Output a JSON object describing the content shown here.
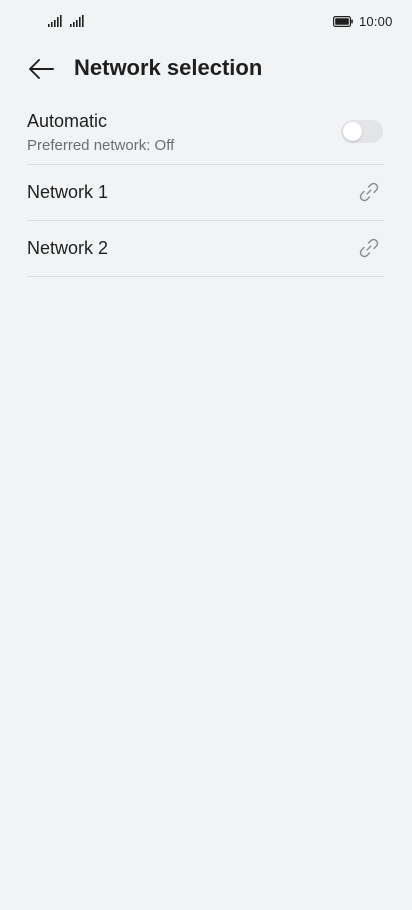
{
  "status_bar": {
    "time": "10:00",
    "icons": [
      "signal-icon",
      "signal-icon",
      "battery-icon"
    ]
  },
  "header": {
    "back_icon": "arrow-left-icon",
    "title": "Network selection"
  },
  "automatic": {
    "title": "Automatic",
    "subtitle": "Preferred network: Off",
    "toggle_on": false
  },
  "networks": [
    {
      "label": "Network 1",
      "icon": "link-icon"
    },
    {
      "label": "Network 2",
      "icon": "link-icon"
    }
  ],
  "colors": {
    "background": "#f1f3f5",
    "text_primary": "#1f1f1f",
    "text_secondary": "#6b6e72",
    "divider": "#dcdfe2",
    "toggle_off_track": "#e2e4e7"
  }
}
